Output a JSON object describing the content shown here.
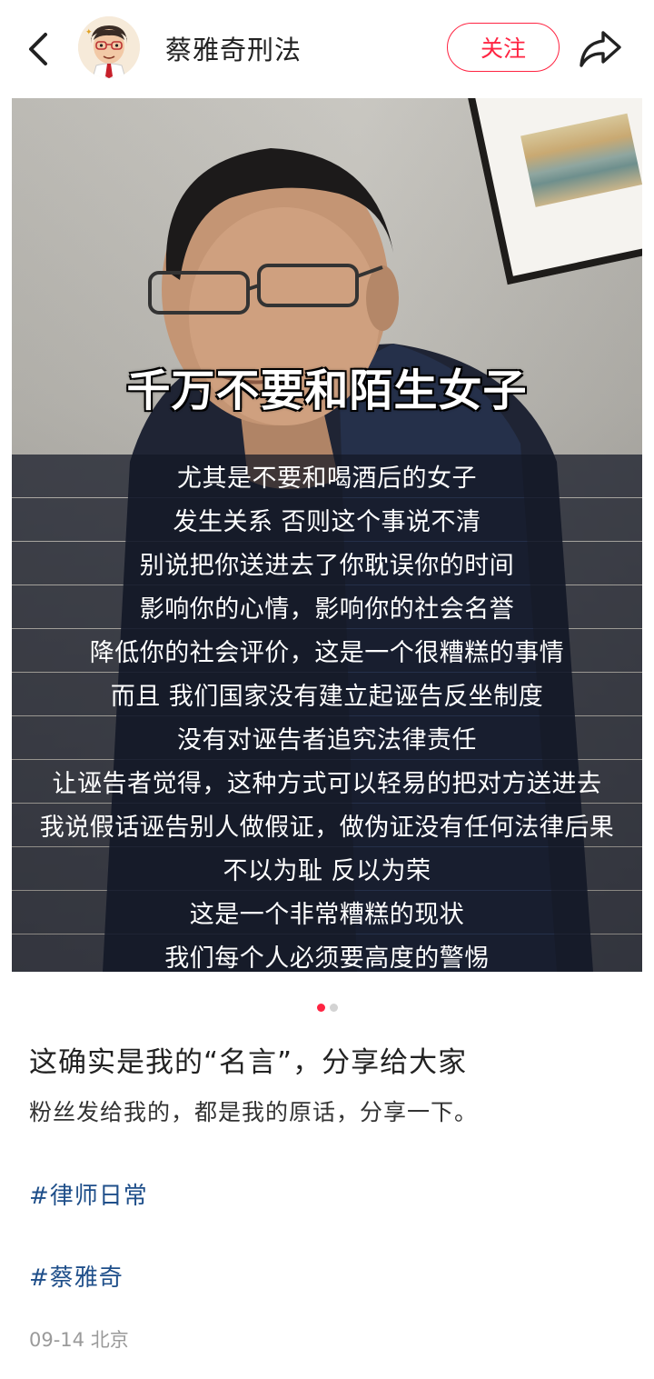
{
  "header": {
    "author_name": "蔡雅奇刑法",
    "follow_label": "关注",
    "back_icon": "chevron-left-icon",
    "share_icon": "share-icon",
    "accent_color": "#ff2442"
  },
  "media": {
    "headline": "千万不要和陌生女子",
    "captions": [
      "尤其是不要和喝酒后的女子",
      "发生关系 否则这个事说不清",
      "别说把你送进去了你耽误你的时间",
      "影响你的心情，影响你的社会名誉",
      "降低你的社会评价，这是一个很糟糕的事情",
      "而且 我们国家没有建立起诬告反坐制度",
      "没有对诬告者追究法律责任",
      "让诬告者觉得，这种方式可以轻易的把对方送进去",
      "我说假话诬告别人做假证，做伪证没有任何法律后果",
      "不以为耻 反以为荣",
      "这是一个非常糟糕的现状",
      "我们每个人必须要高度的警惕"
    ],
    "pages_total": 2,
    "page_current": 1
  },
  "post": {
    "title": "这确实是我的“名言”，分享给大家",
    "body": "粉丝发给我的，都是我的原话，分享一下。",
    "tags": [
      "#律师日常",
      "#蔡雅奇"
    ],
    "date": "09-14",
    "location": "北京"
  }
}
